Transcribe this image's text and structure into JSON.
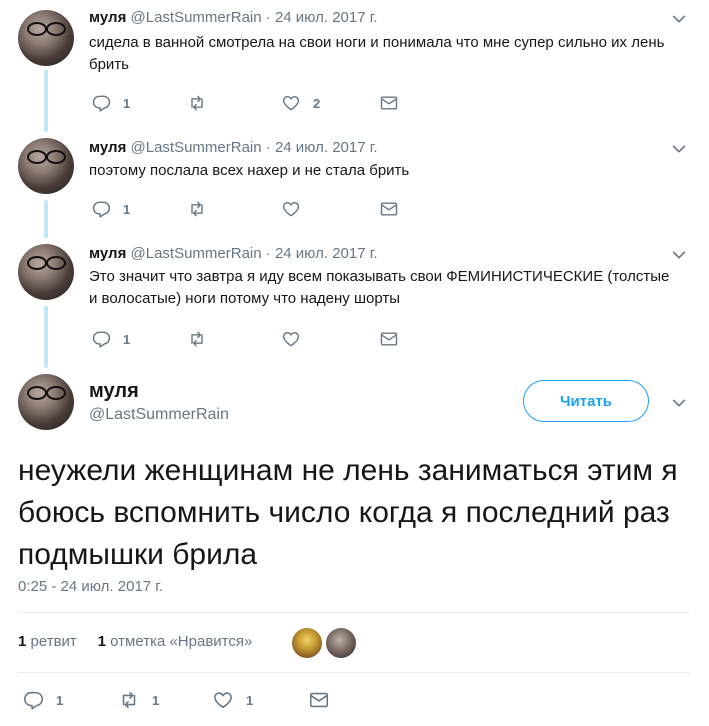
{
  "tweets": [
    {
      "name": "муля",
      "handle": "@LastSummerRain",
      "dot": "·",
      "date": "24 июл. 2017 г.",
      "text": "сидела в ванной смотрела на свои ноги и понимала что мне супер сильно их лень брить",
      "replies": "1",
      "retweets": "",
      "likes": "2"
    },
    {
      "name": "муля",
      "handle": "@LastSummerRain",
      "dot": "·",
      "date": "24 июл. 2017 г.",
      "text": "поэтому послала всех нахер и не стала брить",
      "replies": "1",
      "retweets": "",
      "likes": ""
    },
    {
      "name": "муля",
      "handle": "@LastSummerRain",
      "dot": "·",
      "date": "24 июл. 2017 г.",
      "text": "Это значит что завтра я иду всем показывать свои ФЕМИНИСТИЧЕСКИЕ (толстые и волосатые) ноги потому что надену шорты",
      "replies": "1",
      "retweets": "",
      "likes": ""
    }
  ],
  "main": {
    "name": "муля",
    "handle": "@LastSummerRain",
    "follow_label": "Читать",
    "text": "неужели женщинам не лень заниматься этим я боюсь вспомнить число когда я последний раз подмышки брила",
    "timestamp": "0:25 - 24 июл. 2017 г.",
    "retweet_count": "1",
    "retweet_label": "ретвит",
    "like_count": "1",
    "like_label": "отметка «Нравится»",
    "replies": "1",
    "retweets": "1",
    "likes": "1"
  },
  "icons": {
    "reply": "reply-icon",
    "retweet": "retweet-icon",
    "like": "heart-icon",
    "message": "envelope-icon",
    "more": "chevron-down-icon"
  },
  "colors": {
    "accent": "#1da1f2",
    "muted": "#657786",
    "text": "#14171a",
    "thread_line": "#bfe5f7"
  }
}
